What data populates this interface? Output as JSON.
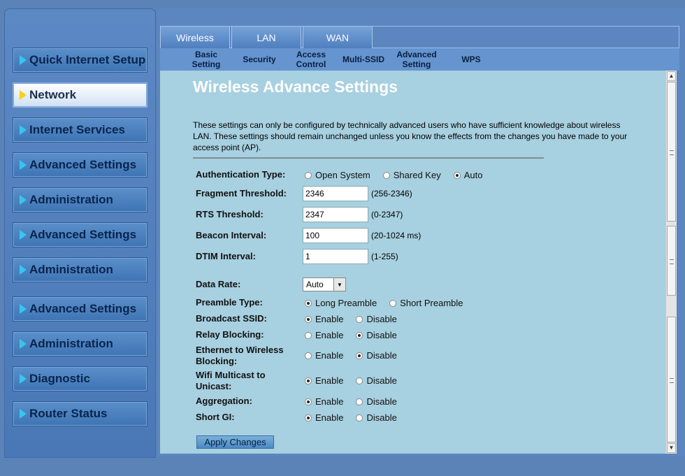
{
  "sidebar": {
    "items": [
      {
        "label": "Quick Internet Setup",
        "active": false
      },
      {
        "label": "Network",
        "active": true
      },
      {
        "label": "Internet Services",
        "active": false
      },
      {
        "label": "Advanced Settings",
        "active": false
      },
      {
        "label": "Administration",
        "active": false
      },
      {
        "label": "Advanced Settings",
        "active": false
      },
      {
        "label": "Administration",
        "active": false
      },
      {
        "label": "Advanced Settings",
        "active": false
      },
      {
        "label": "Administration",
        "active": false
      },
      {
        "label": "Diagnostic",
        "active": false
      },
      {
        "label": "Router Status",
        "active": false
      }
    ]
  },
  "tabs": [
    "Wireless",
    "LAN",
    "WAN"
  ],
  "subtabs": [
    "Basic Setting",
    "Security",
    "Access Control",
    "Multi-SSID",
    "Advanced Setting",
    "WPS"
  ],
  "page": {
    "title": "Wireless Advance Settings",
    "description": "These settings can only be configured by technically advanced users who have sufficient knowledge about wireless LAN. These settings should remain unchanged unless you know the effects from the changes you have made to your access point (AP)."
  },
  "form": {
    "auth": {
      "label": "Authentication Type:",
      "options": [
        "Open System",
        "Shared Key",
        "Auto"
      ],
      "selected": "Auto"
    },
    "fragment": {
      "label": "Fragment Threshold:",
      "value": "2346",
      "range": "(256-2346)"
    },
    "rts": {
      "label": "RTS Threshold:",
      "value": "2347",
      "range": "(0-2347)"
    },
    "beacon": {
      "label": "Beacon Interval:",
      "value": "100",
      "range": "(20-1024 ms)"
    },
    "dtim": {
      "label": "DTIM Interval:",
      "value": "1",
      "range": "(1-255)"
    },
    "datarate": {
      "label": "Data Rate:",
      "value": "Auto"
    },
    "preamble": {
      "label": "Preamble Type:",
      "options": [
        "Long Preamble",
        "Short Preamble"
      ],
      "selected": "Long Preamble"
    },
    "ssid": {
      "label": "Broadcast SSID:",
      "options": [
        "Enable",
        "Disable"
      ],
      "selected": "Enable"
    },
    "relay": {
      "label": "Relay Blocking:",
      "options": [
        "Enable",
        "Disable"
      ],
      "selected": "Disable"
    },
    "ethwifi": {
      "label": "Ethernet to Wireless Blocking:",
      "options": [
        "Enable",
        "Disable"
      ],
      "selected": "Disable"
    },
    "multicast": {
      "label": "Wifi Multicast to Unicast:",
      "options": [
        "Enable",
        "Disable"
      ],
      "selected": "Enable"
    },
    "aggregation": {
      "label": "Aggregation:",
      "options": [
        "Enable",
        "Disable"
      ],
      "selected": "Enable"
    },
    "shortgi": {
      "label": "Short GI:",
      "options": [
        "Enable",
        "Disable"
      ],
      "selected": "Enable"
    },
    "apply_label": "Apply Changes"
  }
}
